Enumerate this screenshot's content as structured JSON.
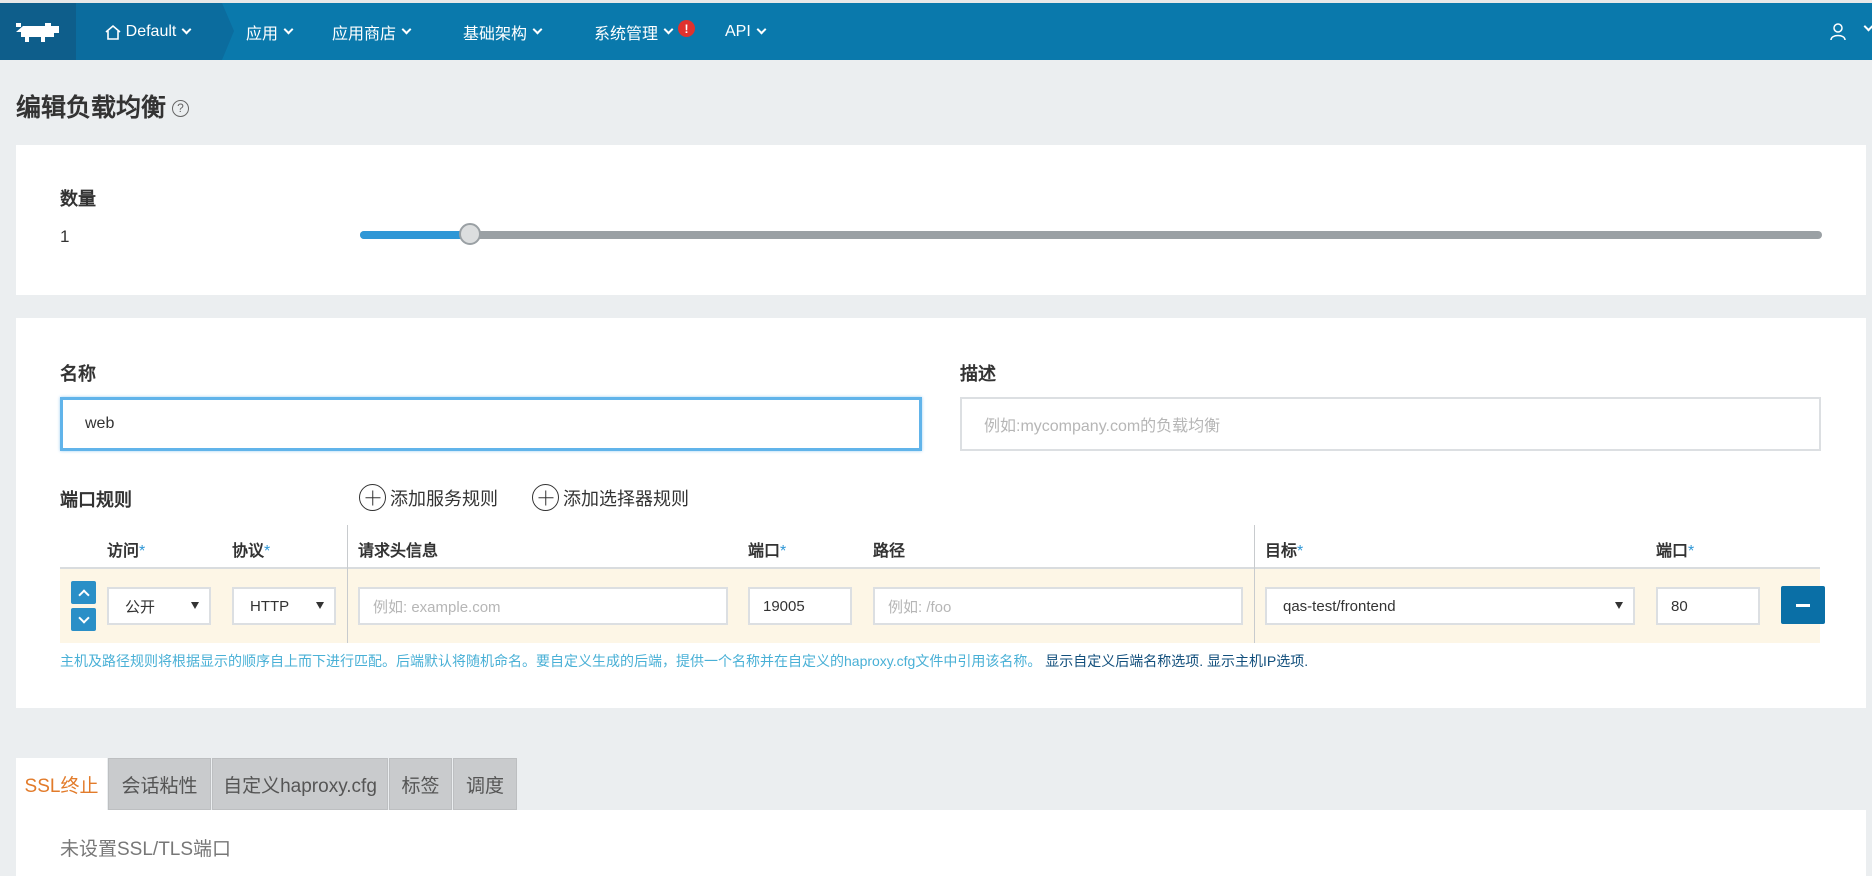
{
  "nav": {
    "environment": "Default",
    "items": [
      {
        "label": "应用"
      },
      {
        "label": "应用商店"
      },
      {
        "label": "基础架构"
      },
      {
        "label": "系统管理",
        "alert": "!"
      },
      {
        "label": "API"
      }
    ]
  },
  "page": {
    "title": "编辑负载均衡",
    "help": "?"
  },
  "scale": {
    "label": "数量",
    "value": "1",
    "fraction": 0.075
  },
  "form": {
    "name_label": "名称",
    "name_value": "web",
    "desc_label": "描述",
    "desc_placeholder": "例如:mycompany.com的负载均衡"
  },
  "port_rules": {
    "label": "端口规则",
    "add_service_rule": "添加服务规则",
    "add_selector_rule": "添加选择器规则",
    "headers": {
      "access": "访问",
      "protocol": "协议",
      "request_host": "请求头信息",
      "port": "端口",
      "path": "路径",
      "target": "目标",
      "target_port": "端口",
      "required_mark": "*"
    },
    "row": {
      "access": "公开",
      "protocol": "HTTP",
      "host_placeholder": "例如: example.com",
      "port": "19005",
      "path_placeholder": "例如: /foo",
      "target": "qas-test/frontend",
      "target_port": "80"
    },
    "hint": "主机及路径规则将根据显示的顺序自上而下进行匹配。后端默认将随机命名。要自定义生成的后端，提供一个名称并在自定义的haproxy.cfg文件中引用该名称。",
    "hint_link_backend": "显示自定义后端名称选项.",
    "hint_link_hostip": "显示主机IP选项."
  },
  "tabs": [
    {
      "label": "SSL终止",
      "active": true
    },
    {
      "label": "会话粘性"
    },
    {
      "label": "自定义haproxy.cfg"
    },
    {
      "label": "标签"
    },
    {
      "label": "调度"
    }
  ],
  "ssl_message": "未设置SSL/TLS端口",
  "colors": {
    "nav": "#0a79ac",
    "accent": "#2f97d6",
    "active_tab": "#e27b2a"
  }
}
